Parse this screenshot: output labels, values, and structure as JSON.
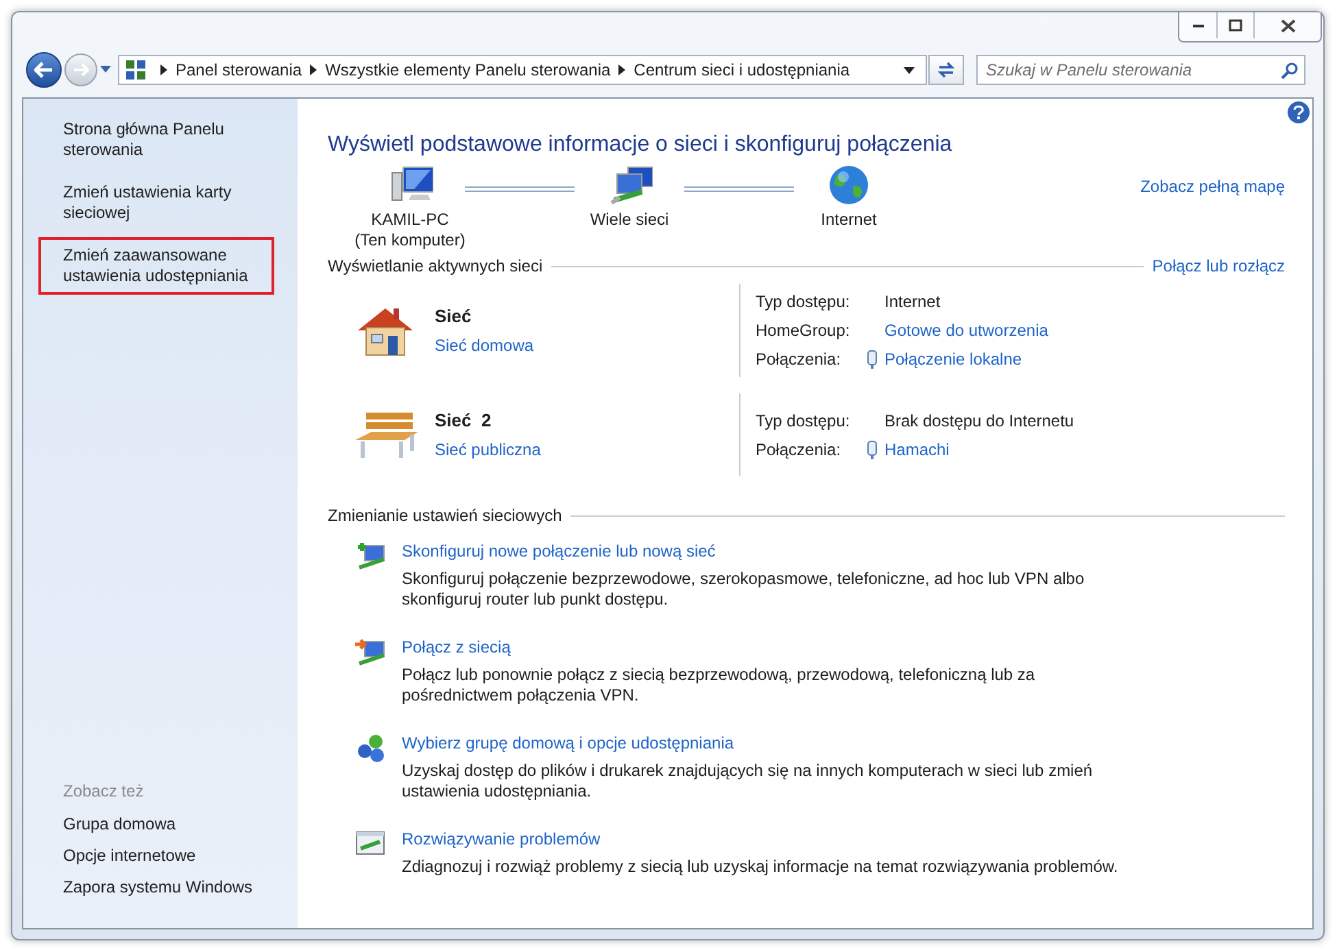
{
  "address_bar": {
    "breadcrumbs": [
      "Panel sterowania",
      "Wszystkie elementy Panelu sterowania",
      "Centrum sieci i udostępniania"
    ]
  },
  "search": {
    "placeholder": "Szukaj w Panelu sterowania"
  },
  "sidebar": {
    "items": [
      {
        "label": "Strona główna Panelu sterowania",
        "highlighted": false
      },
      {
        "label": "Zmień ustawienia karty sieciowej",
        "highlighted": false
      },
      {
        "label": "Zmień zaawansowane ustawienia udostępniania",
        "highlighted": true
      }
    ],
    "see_also": {
      "title": "Zobacz też",
      "items": [
        "Grupa domowa",
        "Opcje internetowe",
        "Zapora systemu Windows"
      ]
    }
  },
  "heading": "Wyświetl podstawowe informacje o sieci i skonfiguruj połączenia",
  "network_map": {
    "nodes": [
      {
        "kind": "computer",
        "label": "KAMIL-PC",
        "sublabel": "(Ten komputer)"
      },
      {
        "kind": "networks",
        "label": "Wiele sieci"
      },
      {
        "kind": "internet",
        "label": "Internet"
      }
    ],
    "full_map_link": "Zobacz pełną mapę"
  },
  "active_networks": {
    "title": "Wyświetlanie aktywnych sieci",
    "action": "Połącz lub rozłącz",
    "networks": [
      {
        "kind": "home",
        "name": "Sieć",
        "type": "Sieć domowa",
        "details": [
          {
            "label": "Typ dostępu:",
            "value": "Internet",
            "kind": "text"
          },
          {
            "label": "HomeGroup:",
            "value": "Gotowe do utworzenia",
            "kind": "link"
          },
          {
            "label": "Połączenia:",
            "value": "Połączenie lokalne",
            "kind": "connection"
          }
        ]
      },
      {
        "kind": "public",
        "name": "Sieć  2",
        "type": "Sieć publiczna",
        "details": [
          {
            "label": "Typ dostępu:",
            "value": "Brak dostępu do Internetu",
            "kind": "text"
          },
          {
            "label": "Połączenia:",
            "value": "Hamachi",
            "kind": "connection"
          }
        ]
      }
    ]
  },
  "change_settings": {
    "title": "Zmienianie ustawień sieciowych",
    "tasks": [
      {
        "kind": "new_connection",
        "title": "Skonfiguruj nowe połączenie lub nową sieć",
        "description": "Skonfiguruj połączenie bezprzewodowe, szerokopasmowe, telefoniczne, ad hoc lub VPN albo skonfiguruj router lub punkt dostępu."
      },
      {
        "kind": "connect",
        "title": "Połącz z siecią",
        "description": "Połącz lub ponownie połącz z siecią bezprzewodową, przewodową, telefoniczną lub za pośrednictwem połączenia VPN."
      },
      {
        "kind": "homegroup",
        "title": "Wybierz grupę domową i opcje udostępniania",
        "description": "Uzyskaj dostęp do plików i drukarek znajdujących się na innych komputerach w sieci lub zmień ustawienia udostępniania."
      },
      {
        "kind": "troubleshoot",
        "title": "Rozwiązywanie problemów",
        "description": "Zdiagnozuj i rozwiąż problemy z siecią lub uzyskaj informacje na temat rozwiązywania problemów."
      }
    ]
  }
}
